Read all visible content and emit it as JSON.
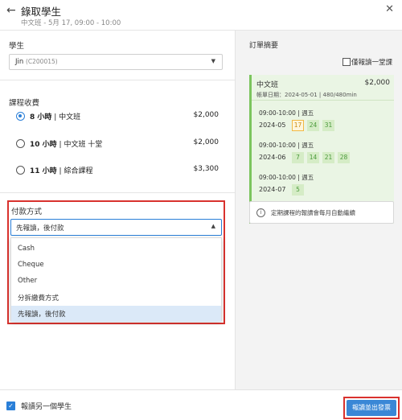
{
  "header": {
    "title": "錄取學生",
    "subtitle": "中文班 - 5月 17, 09:00 - 10:00"
  },
  "student": {
    "label": "學生",
    "value": "Jin",
    "code": "(C200015)"
  },
  "fees": {
    "label": "課程收費",
    "options": [
      {
        "hours": "8 小時",
        "name": "| 中文班",
        "price": "$2,000",
        "selected": true
      },
      {
        "hours": "10 小時",
        "name": "| 中文班 十堂",
        "price": "$2,000",
        "selected": false
      },
      {
        "hours": "11 小時",
        "name": "| 綜合課程",
        "price": "$3,300",
        "selected": false
      }
    ]
  },
  "payment": {
    "label": "付款方式",
    "selected": "先報讀，後付款",
    "options": [
      "Cash",
      "Cheque",
      "Other",
      "分拆繳費方式",
      "先報讀，後付款"
    ]
  },
  "summary": {
    "title": "訂單摘要",
    "only_one_label": "僅報讀一堂課",
    "course_name": "中文班",
    "course_price": "$2,000",
    "billing_info": "帳單日期：2024-05-01 | 480/480min",
    "blocks": [
      {
        "schedule": "09:00-10:00 | 週五",
        "month": "2024-05",
        "days": [
          "17",
          "24",
          "31"
        ]
      },
      {
        "schedule": "09:00-10:00 | 週五",
        "month": "2024-06",
        "days": [
          "7",
          "14",
          "21",
          "28"
        ]
      },
      {
        "schedule": "09:00-10:00 | 週五",
        "month": "2024-07",
        "days": [
          "5"
        ]
      }
    ],
    "notice": "定期課程的報讀會每月自動繼續"
  },
  "footer": {
    "enroll_another": "報讀另一個學生",
    "submit": "報讀並出發票"
  },
  "colors": {
    "accent": "#2a7fd8",
    "highlight_border": "#d9322e",
    "card_bg": "#eaf5e4"
  }
}
